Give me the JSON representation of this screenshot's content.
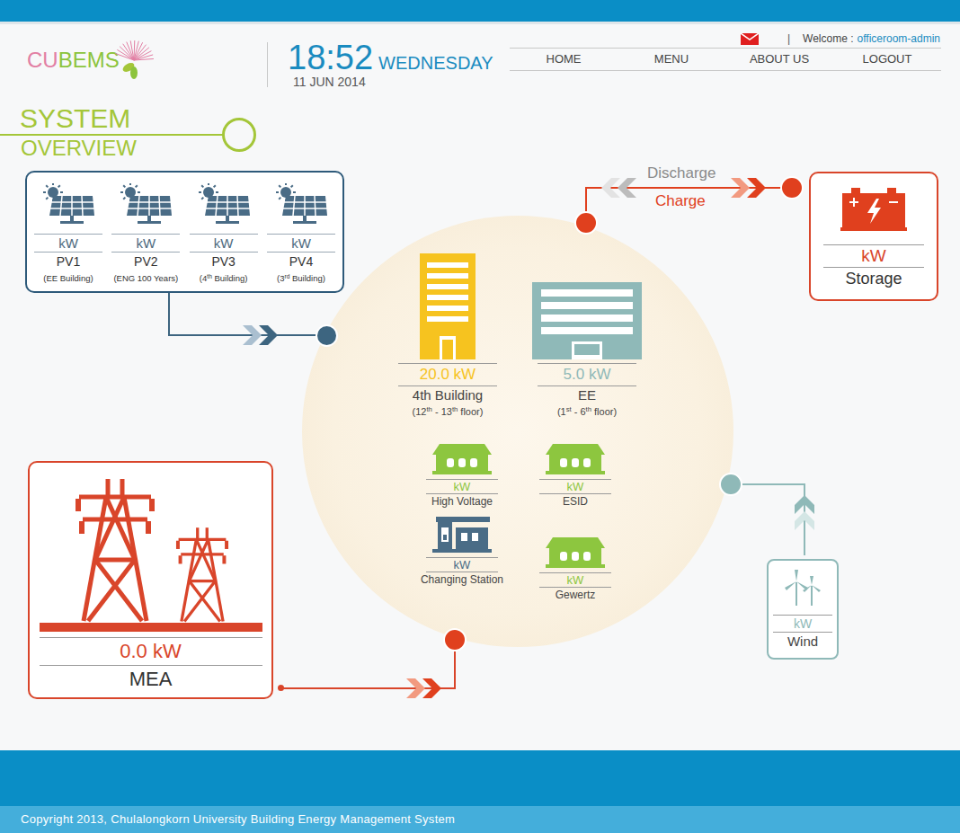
{
  "header": {
    "logo_parts": [
      {
        "text": "CU",
        "color": "#e27fa4"
      },
      {
        "text": "BEMS",
        "color": "#8cc43d"
      }
    ],
    "time": "18:52",
    "day": "WEDNESDAY",
    "date": "11 JUN 2014",
    "separator": "|",
    "welcome_label": "Welcome :",
    "user": "officeroom-admin"
  },
  "nav": [
    {
      "label": "HOME"
    },
    {
      "label": "MENU"
    },
    {
      "label": "ABOUT US"
    },
    {
      "label": "LOGOUT"
    }
  ],
  "section": {
    "title": "SYSTEM",
    "subtitle": "OVERVIEW"
  },
  "pv_panels": [
    {
      "unit": "kW",
      "name": "PV1",
      "location": [
        {
          "text": "(EE Building)",
          "sup": false
        }
      ]
    },
    {
      "unit": "kW",
      "name": "PV2",
      "location": [
        {
          "text": "(ENG 100 Years)",
          "sup": false
        }
      ]
    },
    {
      "unit": "kW",
      "name": "PV3",
      "location": [
        {
          "text": "(4",
          "sup": false
        },
        {
          "text": "th",
          "sup": true
        },
        {
          "text": " Building)",
          "sup": false
        }
      ]
    },
    {
      "unit": "kW",
      "name": "PV4",
      "location": [
        {
          "text": "(3",
          "sup": false
        },
        {
          "text": "rd",
          "sup": true
        },
        {
          "text": " Building)",
          "sup": false
        }
      ]
    }
  ],
  "storage": {
    "value": "kW",
    "label": "Storage",
    "discharge": "Discharge",
    "charge": "Charge"
  },
  "mea": {
    "value": "0.0 kW",
    "label": "MEA"
  },
  "wind": {
    "value": "kW",
    "label": "Wind"
  },
  "buildings": [
    {
      "kind": "tower",
      "value": "20.0 kW",
      "label": "4th Building",
      "color": "#f6c31f",
      "floors": [
        {
          "text": "(12",
          "sup": false
        },
        {
          "text": "th",
          "sup": true
        },
        {
          "text": " - 13",
          "sup": false
        },
        {
          "text": "th",
          "sup": true
        },
        {
          "text": " floor)",
          "sup": false
        }
      ]
    },
    {
      "kind": "block",
      "value": "5.0 kW",
      "label": "EE",
      "color": "#8fb9b8",
      "floors": [
        {
          "text": "(1",
          "sup": false
        },
        {
          "text": "st",
          "sup": true
        },
        {
          "text": " - 6",
          "sup": false
        },
        {
          "text": "th",
          "sup": true
        },
        {
          "text": " floor)",
          "sup": false
        }
      ]
    }
  ],
  "loads": [
    {
      "kind": "house",
      "value": "kW",
      "label": "High Voltage"
    },
    {
      "kind": "house",
      "value": "kW",
      "label": "ESID"
    },
    {
      "kind": "station",
      "value": "kW",
      "label": "Changing Station"
    },
    {
      "kind": "house",
      "value": "kW",
      "label": "Gewertz"
    }
  ],
  "footer": {
    "copyright": "Copyright 2013, Chulalongkorn University Building Energy Management System"
  }
}
